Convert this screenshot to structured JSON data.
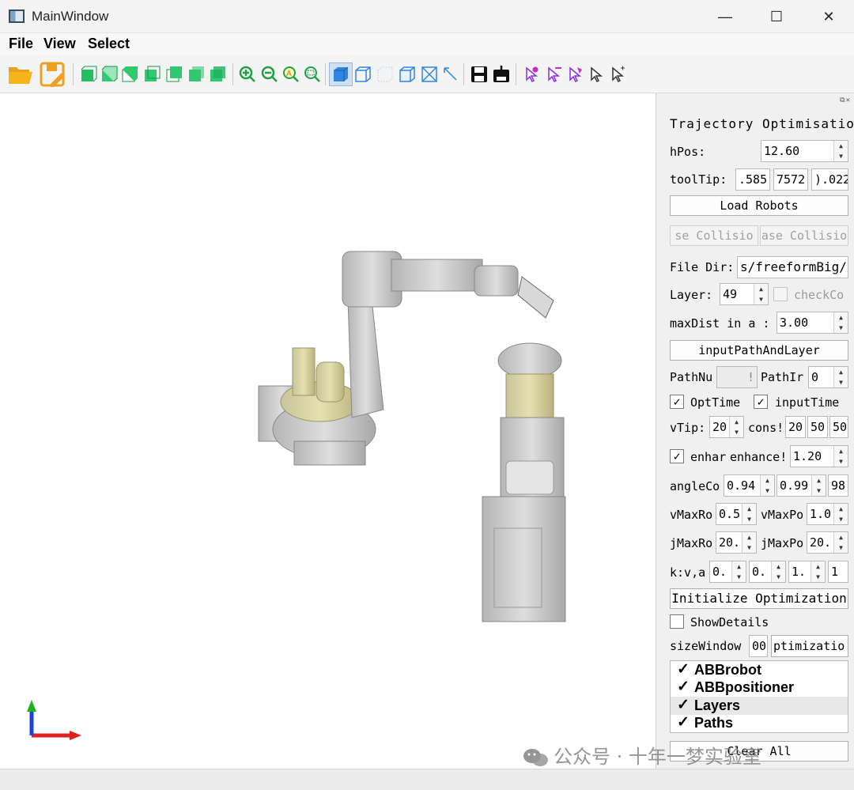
{
  "window": {
    "title": "MainWindow",
    "minimize": "—",
    "maximize": "☐",
    "close": "✕"
  },
  "menu": [
    "File",
    "View",
    "Select"
  ],
  "toolbar": {
    "groups": [
      [
        "open-folder-icon",
        "save-file-icon"
      ],
      [
        "view-front-icon",
        "view-back-icon",
        "view-left-icon",
        "view-right-icon",
        "view-top-icon",
        "view-bottom-icon",
        "view-iso-icon"
      ],
      [
        "zoom-in-icon",
        "zoom-out-icon",
        "zoom-all-icon",
        "zoom-window-icon"
      ],
      [
        "shaded-mode-icon",
        "wireframe-mode-icon",
        "points-mode-icon",
        "box-mode-icon",
        "fit-mode-icon",
        "arrow-mode-icon"
      ],
      [
        "save-image-icon",
        "export-icon"
      ],
      [
        "select-node-icon",
        "select-edge-icon",
        "select-face-icon",
        "select-pointer-icon",
        "select-pointer-alt-icon"
      ]
    ]
  },
  "panel": {
    "title": "Trajectory Optimisatio",
    "hpos_label": "hPos:",
    "hpos_value": "12.60",
    "tooltip_label": "toolTip:",
    "tooltip_values": [
      ".585",
      "7572",
      ").022"
    ],
    "load_robots": "Load Robots",
    "collision_buttons": [
      "se Collisio",
      "ase Collisio"
    ],
    "filedir_label": "File Dir:",
    "filedir_value": "s/freeformBig/",
    "layer_label": "Layer:",
    "layer_value": "49",
    "checkco_label": "checkCo",
    "maxdist_label": "maxDist in a :",
    "maxdist_value": "3.00",
    "input_path_layer": "inputPathAndLayer",
    "pathnum_label": "PathNu",
    "pathnum_value": "!",
    "pathin_label": "PathIr",
    "pathin_value": "0",
    "opttime_label": "OptTime",
    "inputtime_label": "inputTime",
    "vtip_label": "vTip:",
    "vtip_value": "20",
    "cons_label": "cons!",
    "cons_values": [
      "20",
      "50",
      "50"
    ],
    "enhan_label": "enhar",
    "enhance_label": "enhance!",
    "enhance_value": "1.20",
    "angle_label": "angleCo",
    "angle_values": [
      "0.94",
      "0.99",
      "98"
    ],
    "vmaxr_label": "vMaxRo",
    "vmaxr_value": "0.5",
    "vmaxp_label": "vMaxPo",
    "vmaxp_value": "1.0",
    "jmaxr_label": "jMaxRo",
    "jmaxr_value": "20.",
    "jmaxp_label": "jMaxPo",
    "jmaxp_value": "20.",
    "kv_label": "k:v,a",
    "kv_values": [
      "0.",
      "0.",
      "1.",
      "1"
    ],
    "init_opt": "Initialize Optimization",
    "show_details": "ShowDetails",
    "sizewindow_label": "sizeWindow",
    "sizewindow_value": "00",
    "optimizatio_value": "ptimizatio",
    "layers": [
      {
        "label": "ABBrobot",
        "checked": true
      },
      {
        "label": "ABBpositioner",
        "checked": true
      },
      {
        "label": "Layers",
        "checked": true
      },
      {
        "label": "Paths",
        "checked": true
      }
    ],
    "clear_all": "Clear All"
  },
  "watermark": "公众号 · 十年一梦实验室",
  "colors": {
    "robot_gray": "#c8c8c8",
    "base_yellow": "#d9d49a",
    "axis_x": "#e02020",
    "axis_y": "#20b020",
    "axis_z": "#2040e0"
  }
}
